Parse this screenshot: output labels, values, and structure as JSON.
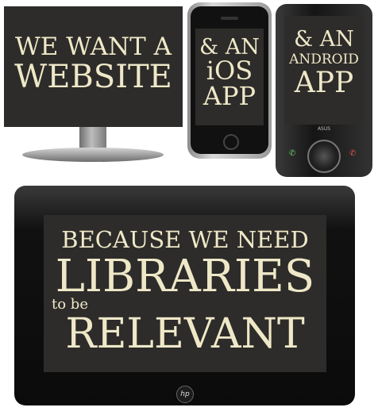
{
  "monitor": {
    "line1": "WE WANT A",
    "line2": "WEBSITE"
  },
  "iphone": {
    "line1": "& AN",
    "line2": "iOS",
    "line3": "APP"
  },
  "android": {
    "line1": "& AN",
    "line2": "ANDROID",
    "line3": "APP",
    "brand": "ASUS"
  },
  "tablet": {
    "line1": "BECAUSE WE NEED",
    "line2": "LIBRARIES",
    "line3": "to be",
    "line4": "RELEVANT",
    "brand": "hp"
  },
  "colors": {
    "screen": "#2d2c2a",
    "text": "#efe8c8"
  }
}
